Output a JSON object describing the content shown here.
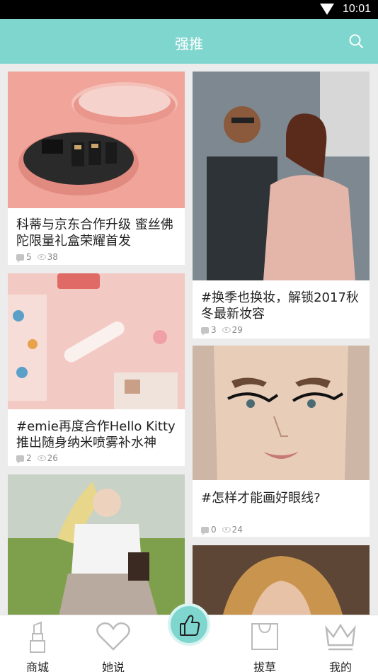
{
  "status": {
    "time": "10:01"
  },
  "header": {
    "title": "强推"
  },
  "cards": [
    {
      "title": "科蒂与京东合作升级 蜜丝佛陀限量礼盒荣耀首发",
      "comments": "5",
      "views": "38"
    },
    {
      "title": "#换季也换妆，解锁2017秋冬最新妆容",
      "comments": "3",
      "views": "29"
    },
    {
      "title": "#emie再度合作Hello Kitty推出随身纳米喷雾补水神",
      "comments": "2",
      "views": "26"
    },
    {
      "title": "#怎样才能画好眼线?",
      "comments": "0",
      "views": "24"
    }
  ],
  "tabs": [
    {
      "label": "商城",
      "icon": "lipstick-icon"
    },
    {
      "label": "她说",
      "icon": "heart-icon"
    },
    {
      "label": "",
      "icon": "thumbs-up-icon"
    },
    {
      "label": "拔草",
      "icon": "shopping-bag-icon"
    },
    {
      "label": "我的",
      "icon": "crown-icon"
    }
  ],
  "colors": {
    "accent": "#7fd6cf",
    "background": "#ececec"
  }
}
